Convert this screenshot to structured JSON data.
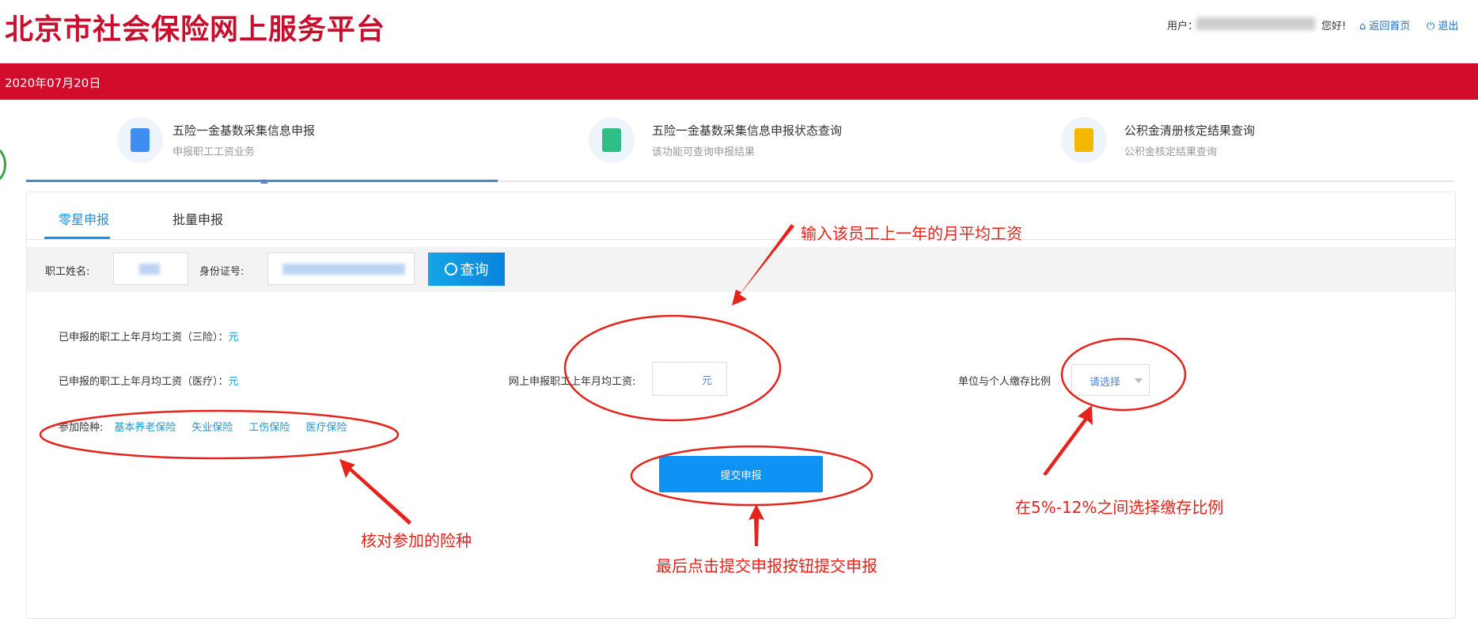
{
  "header": {
    "title": "北京市社会保险网上服务平台",
    "user_label": "用户：",
    "greeting": "您好!",
    "home_link": "返回首页",
    "logout_link": "退出"
  },
  "date_bar": "2020年07月20日",
  "nav": [
    {
      "title": "五险一金基数采集信息申报",
      "subtitle": "申报职工工资业务",
      "icon": "form-edit-icon",
      "color": "#3d8ef0"
    },
    {
      "title": "五险一金基数采集信息申报状态查询",
      "subtitle": "该功能可查询申报结果",
      "icon": "document-query-icon",
      "color": "#2fbf86"
    },
    {
      "title": "公积金清册核定结果查询",
      "subtitle": "公积金核定结果查询",
      "icon": "folder-result-icon",
      "color": "#f5b800"
    }
  ],
  "tabs": [
    {
      "label": "零星申报",
      "active": true
    },
    {
      "label": "批量申报",
      "active": false
    }
  ],
  "search": {
    "name_label": "职工姓名:",
    "id_label": "身份证号:",
    "query_button": "查询"
  },
  "form": {
    "wage_three_label": "已申报的职工上年月均工资（三险）：",
    "wage_three_unit": "元",
    "wage_medical_label": "已申报的职工上年月均工资（医疗）：",
    "wage_medical_unit": "元",
    "insurance_label": "参加险种:",
    "insurances": [
      "基本养老保险",
      "失业保险",
      "工伤保险",
      "医疗保险"
    ],
    "online_wage_label": "网上申报职工上年月均工资:",
    "online_wage_unit": "元",
    "ratio_label": "单位与个人缴存比例",
    "ratio_placeholder": "请选择",
    "submit_button": "提交申报"
  },
  "annotations": {
    "wage": "输入该员工上一年的月平均工资",
    "insurance": "核对参加的险种",
    "submit": "最后点击提交申报按钮提交申报",
    "ratio": "在5%-12%之间选择缴存比例"
  }
}
